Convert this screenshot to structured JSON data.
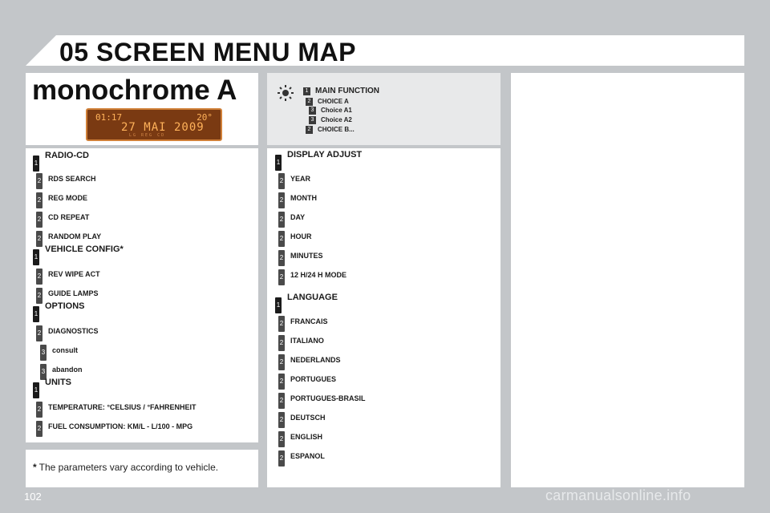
{
  "header": {
    "title": "05 SCREEN MENU MAP"
  },
  "section": {
    "title": "monochrome A"
  },
  "lcd": {
    "time": "01:17",
    "temp": "20°",
    "date": "27 MAI 2009",
    "small": "LG  REG  CD"
  },
  "legend": [
    {
      "level": "1",
      "label": "MAIN FUNCTION"
    },
    {
      "level": "2",
      "label": "CHOICE A"
    },
    {
      "level": "3",
      "label": "Choice A1"
    },
    {
      "level": "3",
      "label": "Choice A2"
    },
    {
      "level": "2",
      "label": "CHOICE B..."
    }
  ],
  "left_menu": [
    {
      "level": "1",
      "label": "RADIO-CD"
    },
    {
      "level": "2",
      "label": "RDS SEARCH"
    },
    {
      "level": "2",
      "label": "REG MODE"
    },
    {
      "level": "2",
      "label": "CD REPEAT"
    },
    {
      "level": "2",
      "label": "RANDOM PLAY"
    },
    {
      "level": "1",
      "label": "VEHICLE CONFIG*"
    },
    {
      "level": "2",
      "label": "REV WIPE ACT"
    },
    {
      "level": "2",
      "label": "GUIDE LAMPS"
    },
    {
      "level": "1",
      "label": "OPTIONS"
    },
    {
      "level": "2",
      "label": "DIAGNOSTICS"
    },
    {
      "level": "3",
      "label": "consult"
    },
    {
      "level": "3",
      "label": "abandon"
    },
    {
      "level": "1",
      "label": "UNITS"
    },
    {
      "level": "2",
      "label": "TEMPERATURE: °CELSIUS / °FAHRENHEIT"
    },
    {
      "level": "2",
      "label": "FUEL CONSUMPTION: KM/L - L/100 - MPG"
    }
  ],
  "right_menu": [
    {
      "level": "1",
      "label": "DISPLAY ADJUST"
    },
    {
      "level": "2",
      "label": "YEAR"
    },
    {
      "level": "2",
      "label": "MONTH"
    },
    {
      "level": "2",
      "label": "DAY"
    },
    {
      "level": "2",
      "label": "HOUR"
    },
    {
      "level": "2",
      "label": "MINUTES"
    },
    {
      "level": "2",
      "label": "12 H/24 H MODE"
    },
    {
      "level": "1",
      "label": "LANGUAGE"
    },
    {
      "level": "2",
      "label": "FRANCAIS"
    },
    {
      "level": "2",
      "label": "ITALIANO"
    },
    {
      "level": "2",
      "label": "NEDERLANDS"
    },
    {
      "level": "2",
      "label": "PORTUGUES"
    },
    {
      "level": "2",
      "label": "PORTUGUES-BRASIL"
    },
    {
      "level": "2",
      "label": "DEUTSCH"
    },
    {
      "level": "2",
      "label": "ENGLISH"
    },
    {
      "level": "2",
      "label": "ESPANOL"
    }
  ],
  "footnote": {
    "star": "*",
    "text": "The parameters vary according to vehicle."
  },
  "page_number": "102",
  "watermark": "carmanualsonline.info"
}
